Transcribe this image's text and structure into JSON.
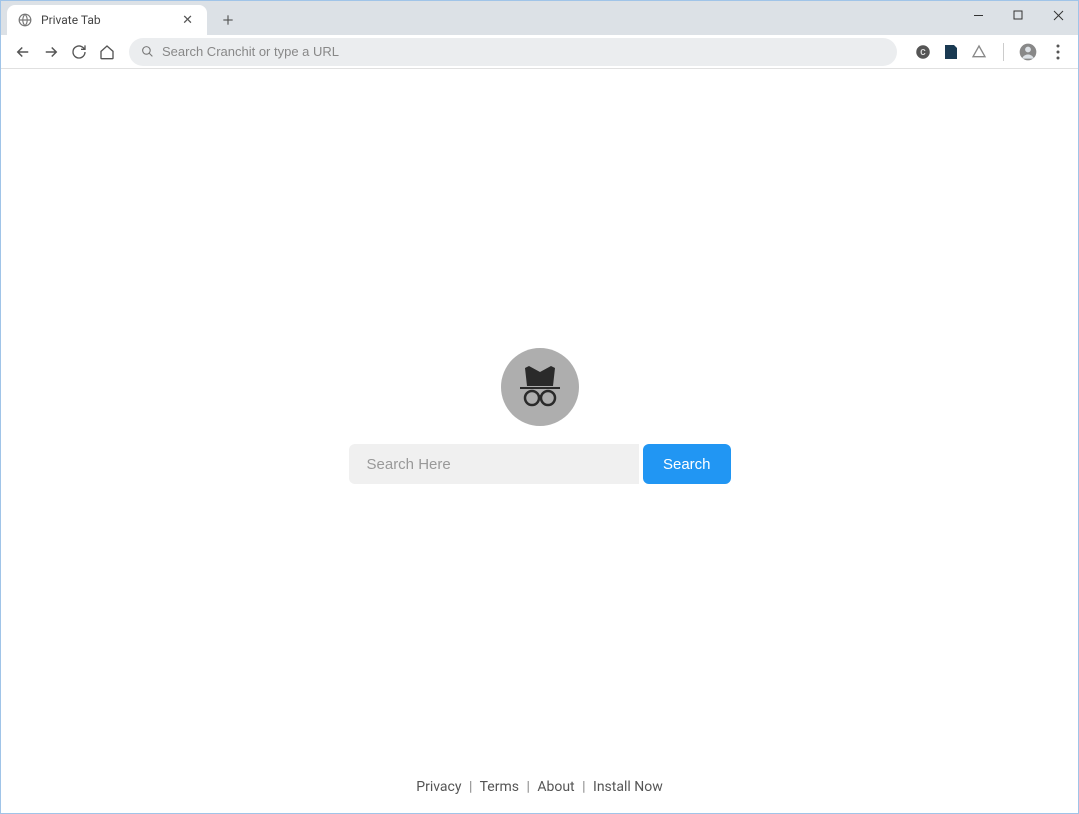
{
  "tab": {
    "title": "Private Tab"
  },
  "toolbar": {
    "address_placeholder": "Search Cranchit or type a URL"
  },
  "page": {
    "search_placeholder": "Search Here",
    "search_button_label": "Search"
  },
  "footer": {
    "links": [
      "Privacy",
      "Terms",
      "About",
      "Install Now"
    ],
    "separator": "|"
  }
}
